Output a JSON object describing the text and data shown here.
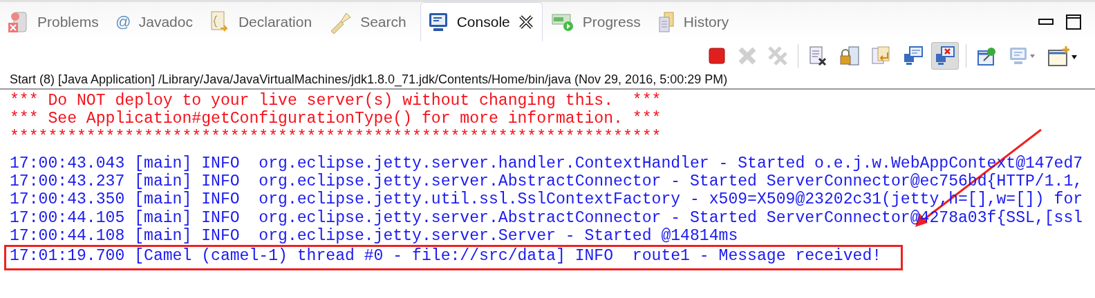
{
  "tabs": [
    {
      "label": "Problems",
      "kind": "problems",
      "selected": false
    },
    {
      "label": "Javadoc",
      "kind": "javadoc",
      "icon_text": "@",
      "selected": false
    },
    {
      "label": "Declaration",
      "kind": "declaration",
      "selected": false
    },
    {
      "label": "Search",
      "kind": "search",
      "selected": false
    },
    {
      "label": "Console",
      "kind": "console",
      "selected": true
    },
    {
      "label": "Progress",
      "kind": "progress",
      "selected": false
    },
    {
      "label": "History",
      "kind": "history",
      "selected": false
    }
  ],
  "toolbar": [
    {
      "kind": "stop",
      "disabled": false,
      "selected": false
    },
    {
      "kind": "remove",
      "disabled": true,
      "selected": false
    },
    {
      "kind": "remove-all",
      "disabled": true,
      "selected": false
    },
    {
      "kind": "clear",
      "disabled": false,
      "selected": false
    },
    {
      "kind": "lock",
      "disabled": false,
      "selected": false
    },
    {
      "kind": "wrap",
      "disabled": false,
      "selected": false
    },
    {
      "kind": "show-out",
      "disabled": false,
      "selected": false
    },
    {
      "kind": "show-err",
      "disabled": false,
      "selected": true
    },
    {
      "kind": "pin",
      "disabled": false,
      "selected": false
    },
    {
      "kind": "display",
      "disabled": false,
      "selected": false
    },
    {
      "kind": "open",
      "disabled": false,
      "selected": false
    }
  ],
  "console": {
    "header": "Start (8) [Java Application] /Library/Java/JavaVirtualMachines/jdk1.8.0_71.jdk/Contents/Home/bin/java (Nov 29, 2016, 5:00:29 PM)",
    "lines": [
      {
        "text": "*** Do NOT deploy to your live server(s) without changing this.  ***",
        "color": "#f5121b",
        "highlighted": false
      },
      {
        "text": "*** See Application#getConfigurationType() for more information. ***",
        "color": "#f5121b",
        "highlighted": false
      },
      {
        "text": "********************************************************************",
        "color": "#f5121b",
        "highlighted": false
      },
      {
        "text": "17:00:43.043 [main] INFO  org.eclipse.jetty.server.handler.ContextHandler - Started o.e.j.w.WebAppContext@147ed7",
        "color": "#1b1bf0",
        "highlighted": false
      },
      {
        "text": "17:00:43.237 [main] INFO  org.eclipse.jetty.server.AbstractConnector - Started ServerConnector@ec756bd{HTTP/1.1,",
        "color": "#1b1bf0",
        "highlighted": false
      },
      {
        "text": "17:00:43.350 [main] INFO  org.eclipse.jetty.util.ssl.SslContextFactory - x509=X509@23202c31(jetty,h=[],w=[]) for",
        "color": "#1b1bf0",
        "highlighted": false
      },
      {
        "text": "17:00:44.105 [main] INFO  org.eclipse.jetty.server.AbstractConnector - Started ServerConnector@4278a03f{SSL,[ssl",
        "color": "#1b1bf0",
        "highlighted": false
      },
      {
        "text": "17:00:44.108 [main] INFO  org.eclipse.jetty.server.Server - Started @14814ms",
        "color": "#1b1bf0",
        "highlighted": false
      },
      {
        "text": "17:01:19.700 [Camel (camel-1) thread #0 - file://src/data] INFO  route1 - Message received!",
        "color": "#1b1bf0",
        "highlighted": true
      }
    ]
  }
}
